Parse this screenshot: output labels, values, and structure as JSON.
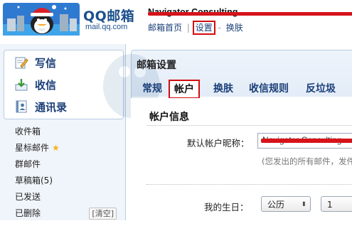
{
  "header": {
    "logo_text": "QQ邮箱",
    "logo_domain": "mail.qq.com",
    "account_name": "Navigator Consulting",
    "nav": {
      "home": "邮箱首页",
      "settings": "设置",
      "skin": "换肤",
      "separator_1": "|",
      "separator_2": "-"
    }
  },
  "sidebar": {
    "actions": [
      {
        "label": "写信",
        "icon": "pencil-icon"
      },
      {
        "label": "收信",
        "icon": "inbox-download-icon"
      },
      {
        "label": "通讯录",
        "icon": "address-book-icon"
      }
    ],
    "folders": [
      {
        "label": "收件箱"
      },
      {
        "label": "星标邮件",
        "badge": "★"
      },
      {
        "label": "群邮件"
      },
      {
        "label": "草稿箱(5)"
      },
      {
        "label": "已发送"
      },
      {
        "label": "已删除",
        "action": "[清空]"
      }
    ]
  },
  "main": {
    "title": "邮箱设置",
    "tabs": [
      {
        "label": "常规"
      },
      {
        "label": "帐户",
        "active": true
      },
      {
        "label": "换肤"
      },
      {
        "label": "收信规则"
      },
      {
        "label": "反垃圾"
      }
    ],
    "section_title": "帐户信息",
    "nickname_label": "默认帐户昵称：",
    "nickname_value": "Navigator Consulting",
    "nickname_hint": "(您发出的所有邮件，发件",
    "birthday_label": "我的生日：",
    "calendar_value": "公历",
    "day_value": "1"
  },
  "colors": {
    "link_blue": "#1a3e78",
    "highlight_red": "#d20c0c",
    "panel_border": "#b9cce3"
  }
}
